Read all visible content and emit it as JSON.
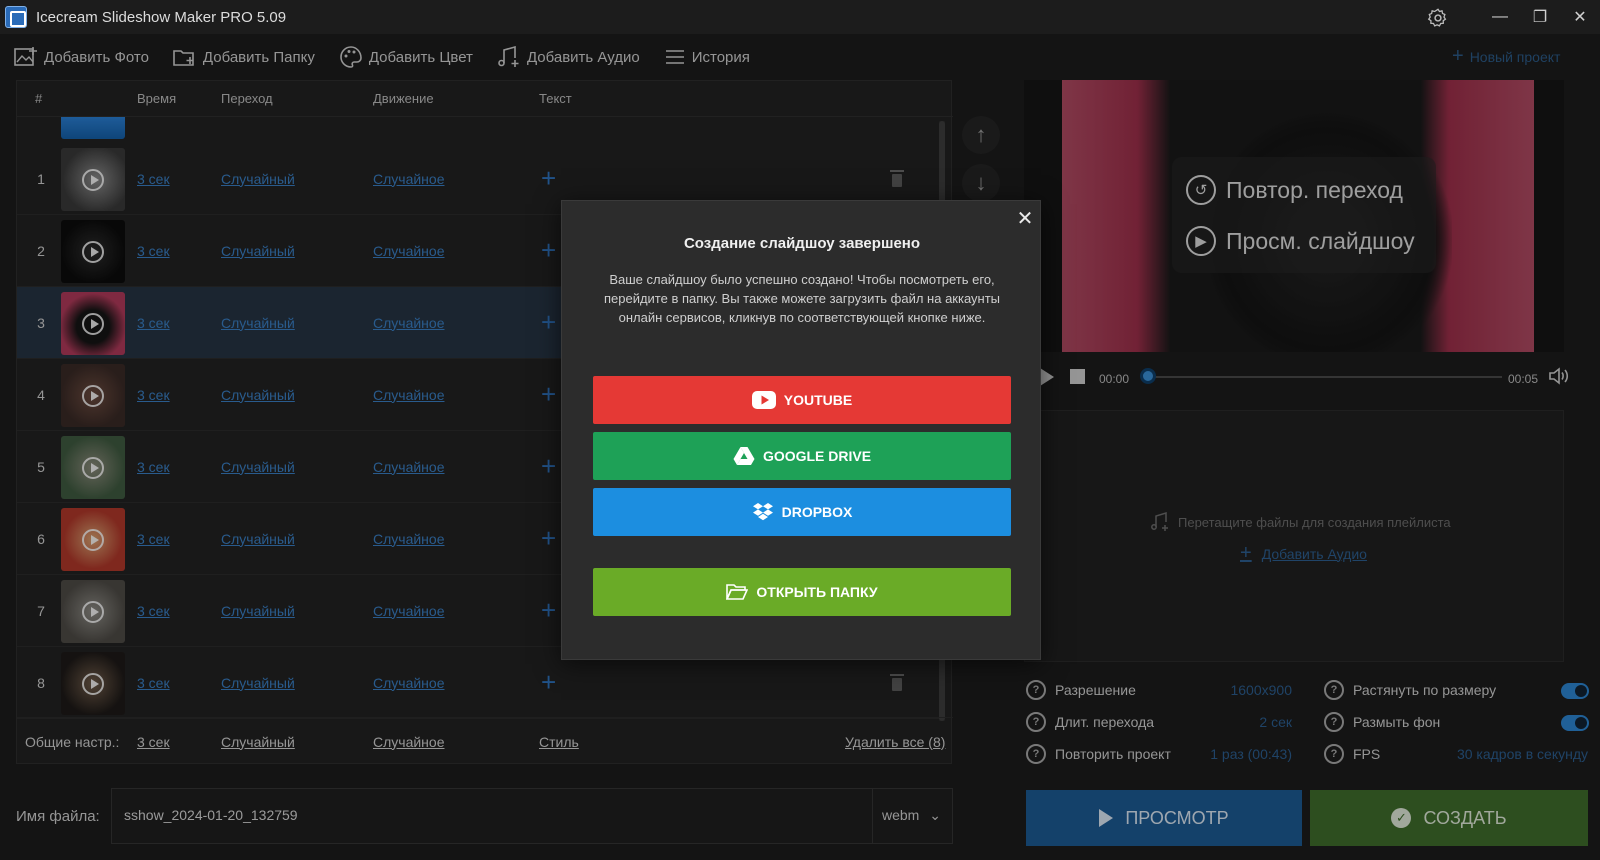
{
  "app": {
    "title": "Icecream Slideshow Maker PRO 5.09",
    "window_controls": [
      "minimize",
      "maximize",
      "close"
    ]
  },
  "toolbar": {
    "add_photo": "Добавить Фото",
    "add_folder": "Добавить Папку",
    "add_color": "Добавить Цвет",
    "add_audio": "Добавить Аудио",
    "history": "История",
    "new_project": "Новый проект"
  },
  "table": {
    "headers": {
      "num": "#",
      "time": "Время",
      "transition": "Переход",
      "motion": "Движение",
      "text": "Текст"
    },
    "rows": [
      {
        "num": "1",
        "time": "3 сек",
        "transition": "Случайный",
        "motion": "Случайное"
      },
      {
        "num": "2",
        "time": "3 сек",
        "transition": "Случайный",
        "motion": "Случайное"
      },
      {
        "num": "3",
        "time": "3 сек",
        "transition": "Случайный",
        "motion": "Случайное",
        "selected": true
      },
      {
        "num": "4",
        "time": "3 сек",
        "transition": "Случайный",
        "motion": "Случайное"
      },
      {
        "num": "5",
        "time": "3 сек",
        "transition": "Случайный",
        "motion": "Случайное"
      },
      {
        "num": "6",
        "time": "3 сек",
        "transition": "Случайный",
        "motion": "Случайное"
      },
      {
        "num": "7",
        "time": "3 сек",
        "transition": "Случайный",
        "motion": "Случайное"
      },
      {
        "num": "8",
        "time": "3 сек",
        "transition": "Случайный",
        "motion": "Случайное"
      }
    ],
    "footer": {
      "label": "Общие настр.:",
      "time": "3 сек",
      "transition": "Случайный",
      "motion": "Случайное",
      "style": "Стиль",
      "delete_all": "Удалить все (8)"
    }
  },
  "file": {
    "label": "Имя файла:",
    "name": "sshow_2024-01-20_132759",
    "format": "webm"
  },
  "preview": {
    "repeat_transition": "Повтор. переход",
    "view_slideshow": "Просм. слайдшоу",
    "time_start": "00:00",
    "time_end": "00:05",
    "progress": 0
  },
  "playlist": {
    "drop_hint": "Перетащите файлы для создания плейлиста",
    "add_audio": "Добавить Аудио"
  },
  "settings": {
    "resolution_label": "Разрешение",
    "resolution_value": "1600x900",
    "transition_len_label": "Длит. перехода",
    "transition_len_value": "2 сек",
    "repeat_label": "Повторить проект",
    "repeat_value": "1 раз (00:43)",
    "stretch_label": "Растянуть по размеру",
    "stretch_on": true,
    "blur_label": "Размыть фон",
    "blur_on": true,
    "fps_label": "FPS",
    "fps_value": "30 кадров в секунду"
  },
  "actions": {
    "preview": "ПРОСМОТР",
    "create": "СОЗДАТЬ"
  },
  "dialog": {
    "title": "Создание слайдшоу завершено",
    "message": "Ваше слайдшоу было успешно создано! Чтобы посмотреть его, перейдите в папку. Вы также можете загрузить файл на аккаунты онлайн сервисов, кликнув по соответствующей кнопке ниже.",
    "youtube": "YOUTUBE",
    "google_drive": "GOOGLE DRIVE",
    "dropbox": "DROPBOX",
    "open_folder": "ОТКРЫТЬ ПАПКУ"
  },
  "colors": {
    "youtube": "#e53935",
    "google_drive": "#1ea157",
    "dropbox": "#1c8ee0",
    "open_folder": "#6aab27",
    "link": "#3a7fc4"
  }
}
